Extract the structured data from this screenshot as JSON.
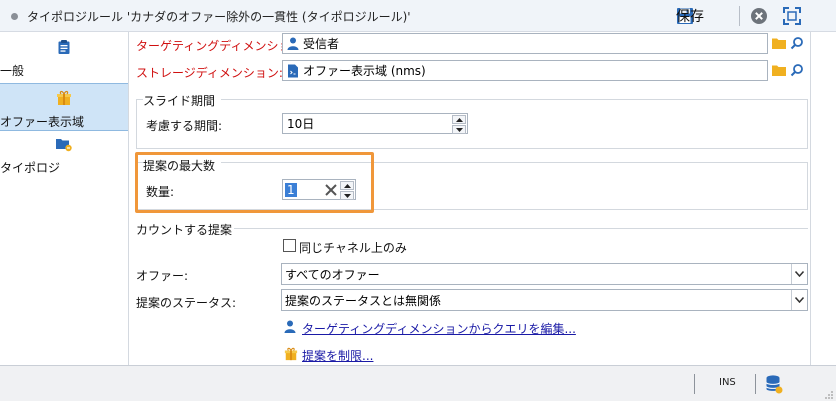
{
  "window": {
    "title": "タイポロジルール 'カナダのオファー除外の一貫性 (タイポロジルール)'",
    "save_label": "保存"
  },
  "sidebar": {
    "items": [
      {
        "label": "一般",
        "icon": "clipboard-icon"
      },
      {
        "label": "オファー表示域",
        "icon": "gift-icon"
      },
      {
        "label": "タイポロジ",
        "icon": "folder-rule-icon"
      }
    ],
    "selected_index": 1
  },
  "targeting": {
    "label": "ターゲティングディメンション:",
    "value": "受信者"
  },
  "storage": {
    "label": "ストレージディメンション:",
    "value": "オファー表示域 (nms)"
  },
  "sliding": {
    "group_title": "スライド期間",
    "period_label": "考慮する期間:",
    "period_value": "10日"
  },
  "maxprop": {
    "group_title": "提案の最大数",
    "qty_label": "数量:",
    "qty_value": "1"
  },
  "counting": {
    "group_title": "カウントする提案",
    "same_channel_label": "同じチャネル上のみ",
    "same_channel_checked": false,
    "offer_label": "オファー:",
    "offer_value": "すべてのオファー",
    "status_label": "提案のステータス:",
    "status_value": "提案のステータスとは無関係",
    "edit_query_link": "ターゲティングディメンションからクエリを編集...",
    "restrict_link": "提案を制限..."
  },
  "status_bar": {
    "mode": "INS"
  },
  "colors": {
    "required_label": "#d01010",
    "highlight": "#f0973a",
    "selected_nav": "#cfe4f7",
    "link": "#1a1aa6"
  }
}
